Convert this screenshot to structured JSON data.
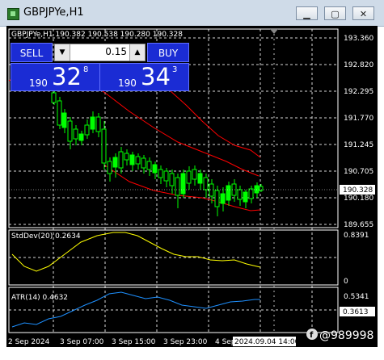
{
  "window": {
    "title": "GBPJPYe,H1",
    "minimize_glyph": "▁",
    "maximize_glyph": "▢",
    "close_glyph": "✕",
    "icon": "chart-app-icon"
  },
  "chart": {
    "header": "GBPJPYe,H1  190.382 190.538 190.280 190.328",
    "price_labels": [
      "193.360",
      "192.820",
      "192.295",
      "191.770",
      "191.245",
      "190.705",
      "190.180",
      "189.655"
    ],
    "current_price": "190.328",
    "time_labels": [
      "2 Sep 2024",
      "3 Sep 07:00",
      "3 Sep 15:00",
      "3 Sep 23:00",
      "4 Sep"
    ],
    "crosshair_time": "2024.09.04 14:00",
    "colors": {
      "bull": "#00ff00",
      "bear": "#00ff00",
      "envelope": "#ff0000",
      "stddev": "#ffff00",
      "atr": "#1e90ff",
      "grid": "#ffffff",
      "background": "#000000"
    }
  },
  "trade_panel": {
    "sell_label": "SELL",
    "buy_label": "BUY",
    "lot_value": "0.15",
    "down_glyph": "▼",
    "up_glyph": "▲",
    "sell_prefix": "190",
    "sell_big": "32",
    "sell_sup": "8",
    "buy_prefix": "190",
    "buy_big": "34",
    "buy_sup": "3"
  },
  "stddev": {
    "label": "StdDev(20) 0.2634",
    "max_label": "0.8391",
    "min_label": "0"
  },
  "atr": {
    "label": "ATR(14) 0.4632",
    "top_label": "0.5341",
    "current_label": "0.3613"
  },
  "watermark": {
    "text": "@989998"
  }
}
